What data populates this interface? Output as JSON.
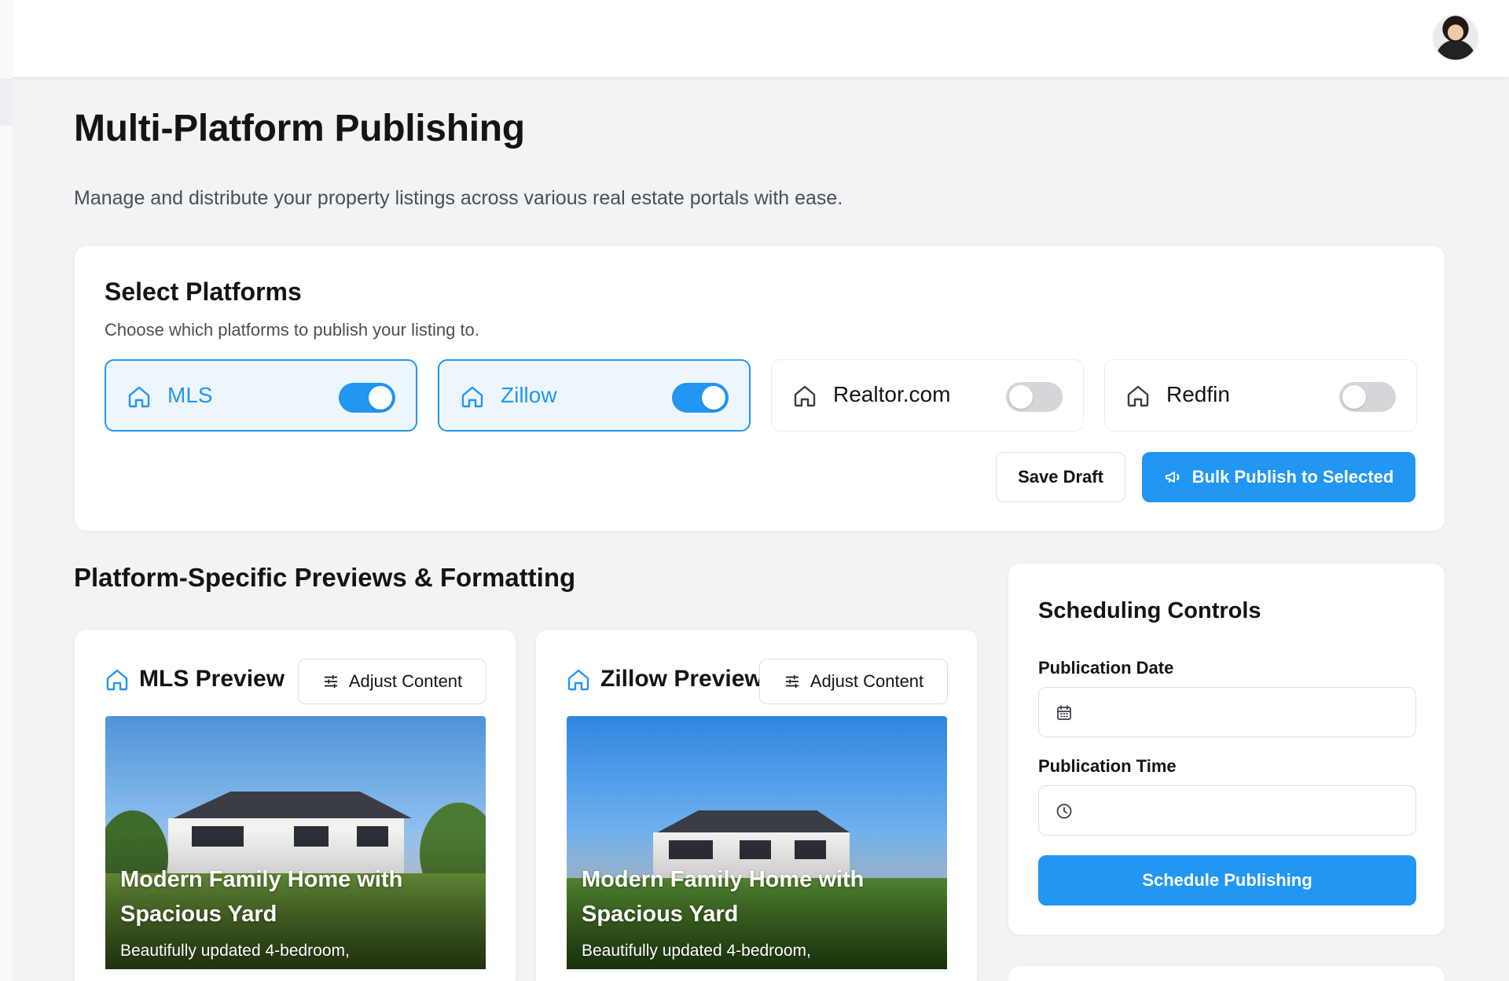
{
  "colors": {
    "accent": "#2196f3",
    "background": "#f2f3f5",
    "card": "#ffffff",
    "text": "#141414",
    "muted": "#4a4f57"
  },
  "header": {
    "avatar_icon": "user-avatar"
  },
  "page": {
    "title": "Multi-Platform Publishing",
    "subtitle": "Manage and distribute your property listings across various real estate portals with ease."
  },
  "select_platforms": {
    "title": "Select Platforms",
    "description": "Choose which platforms to publish your listing to.",
    "platforms": [
      {
        "name": "MLS",
        "enabled": true,
        "icon": "house-icon"
      },
      {
        "name": "Zillow",
        "enabled": true,
        "icon": "house-icon"
      },
      {
        "name": "Realtor.com",
        "enabled": false,
        "icon": "house-icon"
      },
      {
        "name": "Redfin",
        "enabled": false,
        "icon": "house-icon"
      }
    ],
    "save_draft_label": "Save Draft",
    "bulk_publish_label": "Bulk Publish to Selected",
    "bulk_publish_icon": "megaphone-icon"
  },
  "previews": {
    "section_title": "Platform-Specific Previews & Formatting",
    "cards": [
      {
        "title": "MLS Preview",
        "adjust_label": "Adjust Content",
        "listing_title": "Modern Family Home with Spacious Yard",
        "listing_subtitle": "Beautifully updated 4-bedroom,"
      },
      {
        "title": "Zillow Preview",
        "adjust_label": "Adjust Content",
        "listing_title": "Modern Family Home with Spacious Yard",
        "listing_subtitle": "Beautifully updated 4-bedroom,"
      }
    ]
  },
  "scheduling": {
    "title": "Scheduling Controls",
    "date_label": "Publication Date",
    "date_value": "",
    "time_label": "Publication Time",
    "time_value": "",
    "schedule_button_label": "Schedule Publishing"
  }
}
